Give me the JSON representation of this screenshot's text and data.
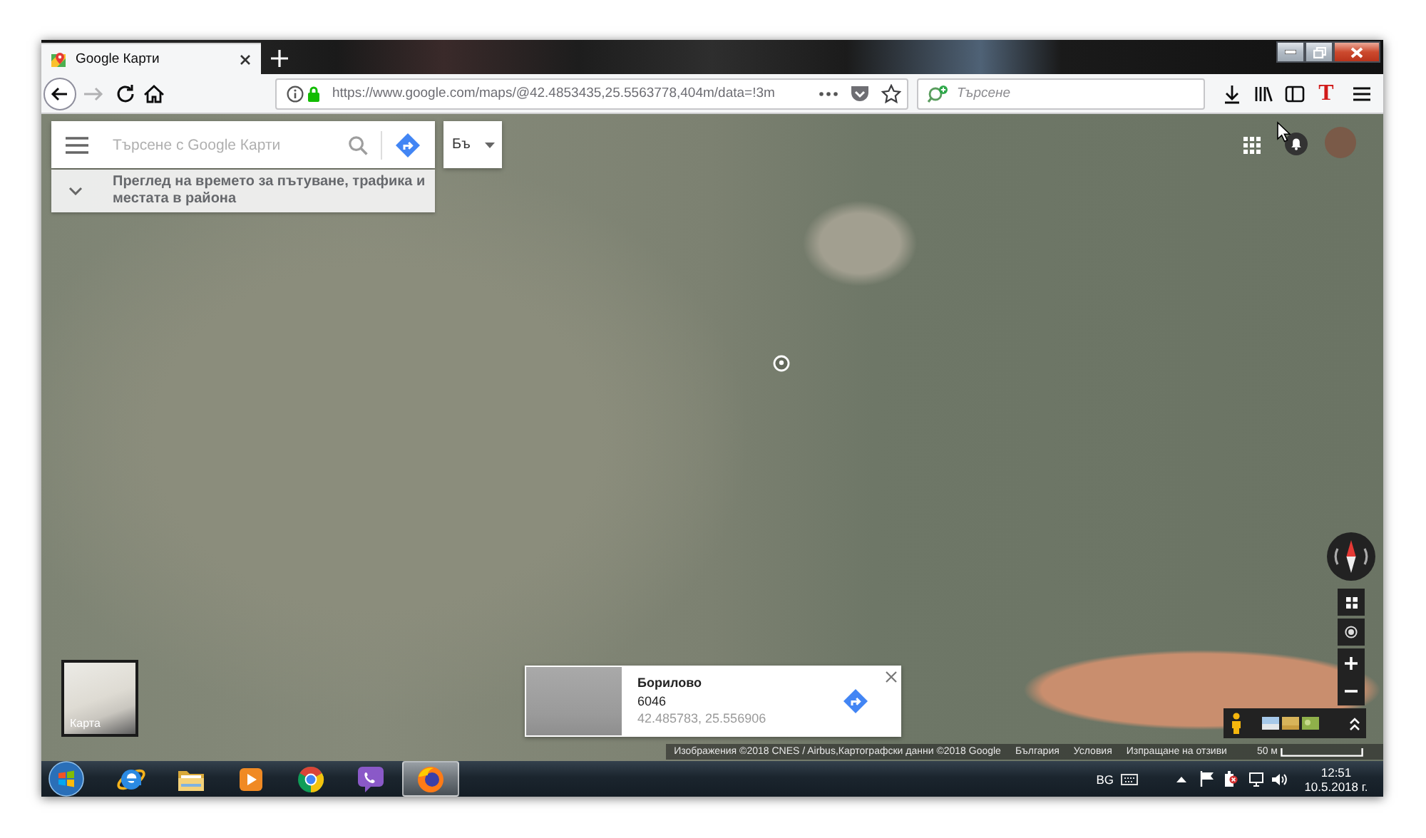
{
  "browser": {
    "tabs": [
      {
        "title": "Google Карти",
        "selected": true
      }
    ],
    "address_bar": {
      "url": "https://www.google.com/maps/@42.4853435,25.5563778,404m/data=!3m"
    },
    "search": {
      "placeholder": "Търсене"
    },
    "extension_button": {
      "label": "T"
    }
  },
  "map": {
    "search_box": {
      "placeholder": "Търсене с Google Карти"
    },
    "language_button": {
      "label": "Бъ"
    },
    "explore_panel": {
      "text": "Преглед на времето за пътуване, трафика и местата в района"
    },
    "layer_switcher": {
      "label": "Карта"
    },
    "place_card": {
      "name": "Борилово",
      "postal_code": "6046",
      "coordinates": "42.485783, 25.556906"
    },
    "attribution": {
      "imagery": "Изображения ©2018 CNES / Airbus,Картографски данни ©2018 Google",
      "links": [
        "България",
        "Условия",
        "Изпращане на отзиви"
      ],
      "scale": "50 м"
    }
  },
  "taskbar": {
    "apps": [
      {
        "kind": "ie",
        "selected": false
      },
      {
        "kind": "folder",
        "selected": false
      },
      {
        "kind": "media",
        "selected": false
      },
      {
        "kind": "chrome",
        "selected": false
      },
      {
        "kind": "viber",
        "selected": false
      },
      {
        "kind": "firefox",
        "selected": true
      }
    ],
    "language": "BG",
    "time": "12:51",
    "date": "10.5.2018 г."
  }
}
